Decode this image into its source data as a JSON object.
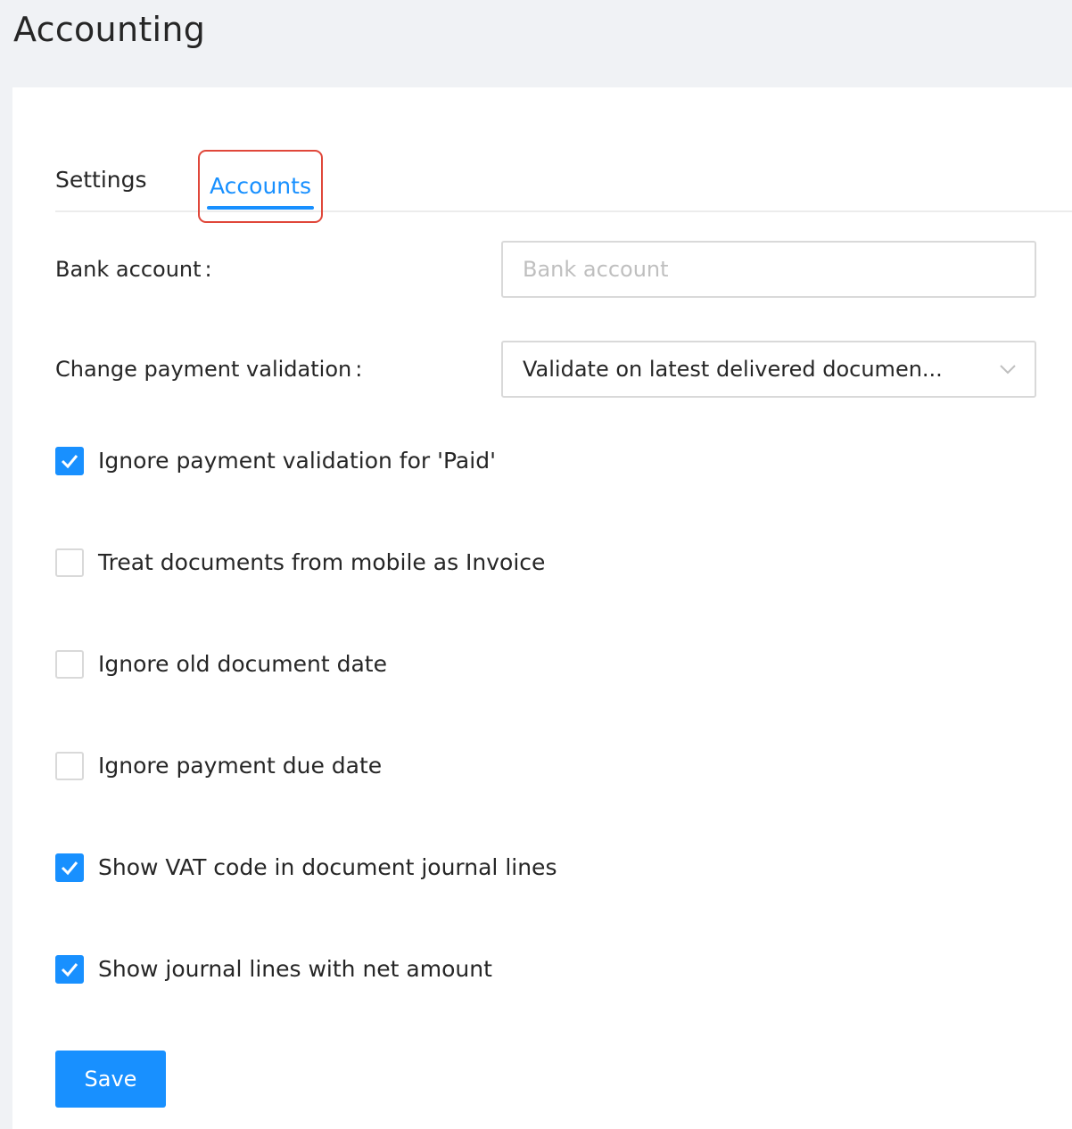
{
  "page": {
    "title": "Accounting"
  },
  "tabs": [
    {
      "label": "Settings",
      "active": false
    },
    {
      "label": "Accounts",
      "active": true
    }
  ],
  "form": {
    "bank_account": {
      "label": "Bank account",
      "label_suffix": ":",
      "value": "",
      "placeholder": "Bank account"
    },
    "change_payment_validation": {
      "label": "Change payment validation",
      "label_suffix": ":",
      "selected": "Validate on latest delivered documen..."
    },
    "checkboxes": [
      {
        "label": "Ignore payment validation for 'Paid'",
        "checked": true
      },
      {
        "label": "Treat documents from mobile as Invoice",
        "checked": false
      },
      {
        "label": "Ignore old document date",
        "checked": false
      },
      {
        "label": "Ignore payment due date",
        "checked": false
      },
      {
        "label": "Show VAT code in document journal lines",
        "checked": true
      },
      {
        "label": "Show journal lines with net amount",
        "checked": true
      }
    ],
    "save_label": "Save"
  },
  "colors": {
    "primary": "#1890ff",
    "highlight_border": "#e0473a",
    "background": "#f0f2f5"
  },
  "icons": {
    "checkmark": "check-icon",
    "dropdown": "chevron-down-icon"
  }
}
